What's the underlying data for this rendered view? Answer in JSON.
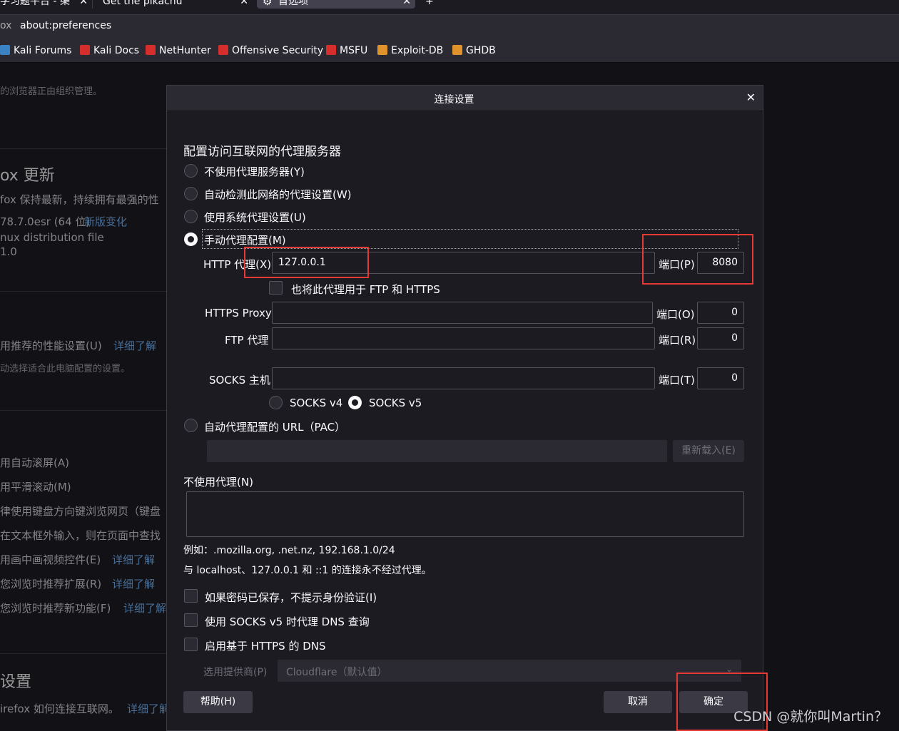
{
  "tabs": [
    {
      "label": "学习题平台 - 渠",
      "close": "✕"
    },
    {
      "label": "Get the pikachu",
      "close": "✕"
    },
    {
      "label": "首选项",
      "close": "✕"
    },
    {
      "label": "+"
    }
  ],
  "urlbar": {
    "prefix": "ox",
    "url": "about:preferences"
  },
  "bookmarks": [
    {
      "label": "Kali Forums",
      "icon_color": "#3b82c4"
    },
    {
      "label": "Kali Docs",
      "icon_color": "#d62d2d"
    },
    {
      "label": "NetHunter",
      "icon_color": "#d62d2d"
    },
    {
      "label": "Offensive Security",
      "icon_color": "#d62d2d"
    },
    {
      "label": "MSFU",
      "icon_color": "#d62d2d"
    },
    {
      "label": "Exploit-DB",
      "icon_color": "#e0932b"
    },
    {
      "label": "GHDB",
      "icon_color": "#e0932b"
    }
  ],
  "background": {
    "managed_notice": "的浏览器正由组织管理。",
    "update_title": "ox 更新",
    "update_desc": "fox 保持最新，持续拥有最强的性",
    "version": "78.7.0esr (64 位)",
    "whats_new": "新版变化",
    "dist1": "nux distribution file",
    "dist2": "1.0",
    "perf_setting": "用推荐的性能设置(U)",
    "learn_more": "详细了解",
    "perf_desc": "动选择适合此电脑配置的设置。",
    "autoscroll": "用自动滚屏(A)",
    "smooth": "用平滑滚动(M)",
    "caret": "律使用键盘方向键浏览网页（键盘",
    "find": "在文本框外输入，则在页面中查找",
    "pip": "用画中画视频控件(E)",
    "ext": "您浏览时推荐扩展(R)",
    "features": "您浏览时推荐新功能(F)",
    "net_title": "设置",
    "net_desc": "irefox 如何连接互联网。"
  },
  "dialog": {
    "title": "连接设置",
    "close": "✕",
    "heading": "配置访问互联网的代理服务器",
    "options": {
      "no_proxy": "不使用代理服务器(Y)",
      "auto_detect": "自动检测此网络的代理设置(W)",
      "system": "使用系统代理设置(U)",
      "manual": "手动代理配置(M)",
      "pac": "自动代理配置的 URL（PAC）"
    },
    "selected_option": "manual",
    "http": {
      "label": "HTTP 代理(X)",
      "value": "127.0.0.1",
      "port_label": "端口(P)",
      "port": "8080"
    },
    "also_use": "也将此代理用于 FTP 和 HTTPS",
    "https": {
      "label": "HTTPS Proxy",
      "value": "",
      "port_label": "端口(O)",
      "port": "0"
    },
    "ftp": {
      "label": "FTP 代理",
      "value": "",
      "port_label": "端口(R)",
      "port": "0"
    },
    "socks": {
      "label": "SOCKS 主机",
      "value": "",
      "port_label": "端口(T)",
      "port": "0"
    },
    "socks_v4": "SOCKS v4",
    "socks_v5": "SOCKS v5",
    "socks_selected": "v5",
    "pac_url": "",
    "reload": "重新载入(E)",
    "no_proxy_for": "不使用代理(N)",
    "no_proxy_value": "",
    "example": "例如：.mozilla.org, .net.nz, 192.168.1.0/24",
    "localhost_note": "与 localhost、127.0.0.1 和 ::1 的连接永不经过代理。",
    "chk_auth": "如果密码已保存，不提示身份验证(I)",
    "chk_dns": "使用 SOCKS v5 时代理 DNS 查询",
    "chk_doh": "启用基于 HTTPS 的 DNS",
    "provider_label": "选用提供商(P)",
    "provider_value": "Cloudflare（默认值）",
    "help": "帮助(H)",
    "cancel": "取消",
    "ok": "确定"
  },
  "watermark": "CSDN @就你叫Martin？",
  "colors": {
    "annotation": "#e53935",
    "link": "#6da8e6",
    "dialog_bg": "#1c1b22"
  }
}
